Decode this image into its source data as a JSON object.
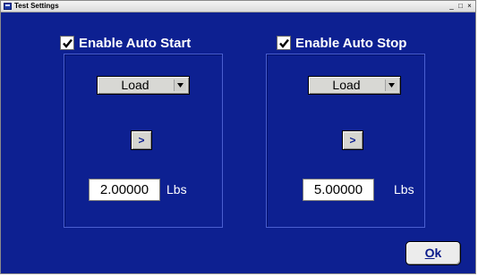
{
  "window": {
    "title": "Test Settings",
    "min_glyph": "_",
    "max_glyph": "□",
    "close_glyph": "×"
  },
  "auto_start": {
    "label": "Enable Auto Start",
    "checked": true,
    "mode": "Load",
    "apply_label": ">",
    "value": "2.00000",
    "unit": "Lbs"
  },
  "auto_stop": {
    "label": "Enable Auto Stop",
    "checked": true,
    "mode": "Load",
    "apply_label": ">",
    "value": "5.00000",
    "unit": "Lbs"
  },
  "ok": {
    "mnemonic": "O",
    "rest": "k"
  },
  "icons": {
    "check": "check-icon",
    "dropdown": "chevron-down-icon",
    "app": "app-icon"
  },
  "colors": {
    "background": "#0d2091",
    "text": "#ffffff",
    "button": "#d6d6d0"
  }
}
